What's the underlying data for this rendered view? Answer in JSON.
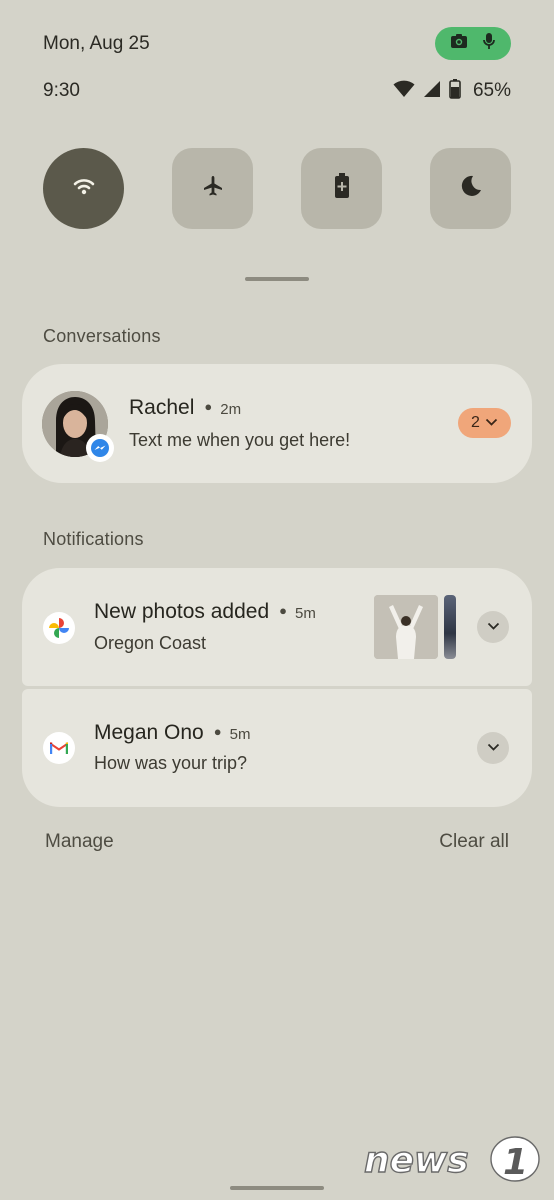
{
  "status_bar": {
    "date": "Mon, Aug 25",
    "time": "9:30",
    "battery_percent": "65%",
    "privacy_chip_color": "#4fb86c",
    "privacy_icons": [
      "camera-icon",
      "microphone-icon"
    ],
    "icons": [
      "wifi-icon",
      "cellular-signal-icon",
      "battery-icon"
    ]
  },
  "quick_settings": {
    "tiles": [
      {
        "name": "wifi",
        "icon": "wifi-icon",
        "active": true
      },
      {
        "name": "airplane-mode",
        "icon": "airplane-icon",
        "active": false
      },
      {
        "name": "battery-saver",
        "icon": "battery-saver-icon",
        "active": false
      },
      {
        "name": "dark-theme",
        "icon": "moon-icon",
        "active": false
      }
    ]
  },
  "conversations": {
    "section_label": "Conversations",
    "items": [
      {
        "name": "Rachel",
        "time": "2m",
        "message": "Text me when you get here!",
        "count": "2",
        "app_badge": "messenger-icon",
        "count_chip_color": "#f0a67a"
      }
    ]
  },
  "notifications": {
    "section_label": "Notifications",
    "items": [
      {
        "title": "New photos added",
        "time": "5m",
        "subtitle": "Oregon Coast",
        "app_icon": "google-photos-icon"
      },
      {
        "title": "Megan Ono",
        "time": "5m",
        "subtitle": "How was your trip?",
        "app_icon": "gmail-icon"
      }
    ]
  },
  "footer": {
    "manage_label": "Manage",
    "clear_all_label": "Clear all"
  },
  "colors": {
    "background": "#d4d3c9",
    "card": "#e6e5dd",
    "tile_active": "#5b594b",
    "tile_inactive": "#b8b6aa"
  }
}
